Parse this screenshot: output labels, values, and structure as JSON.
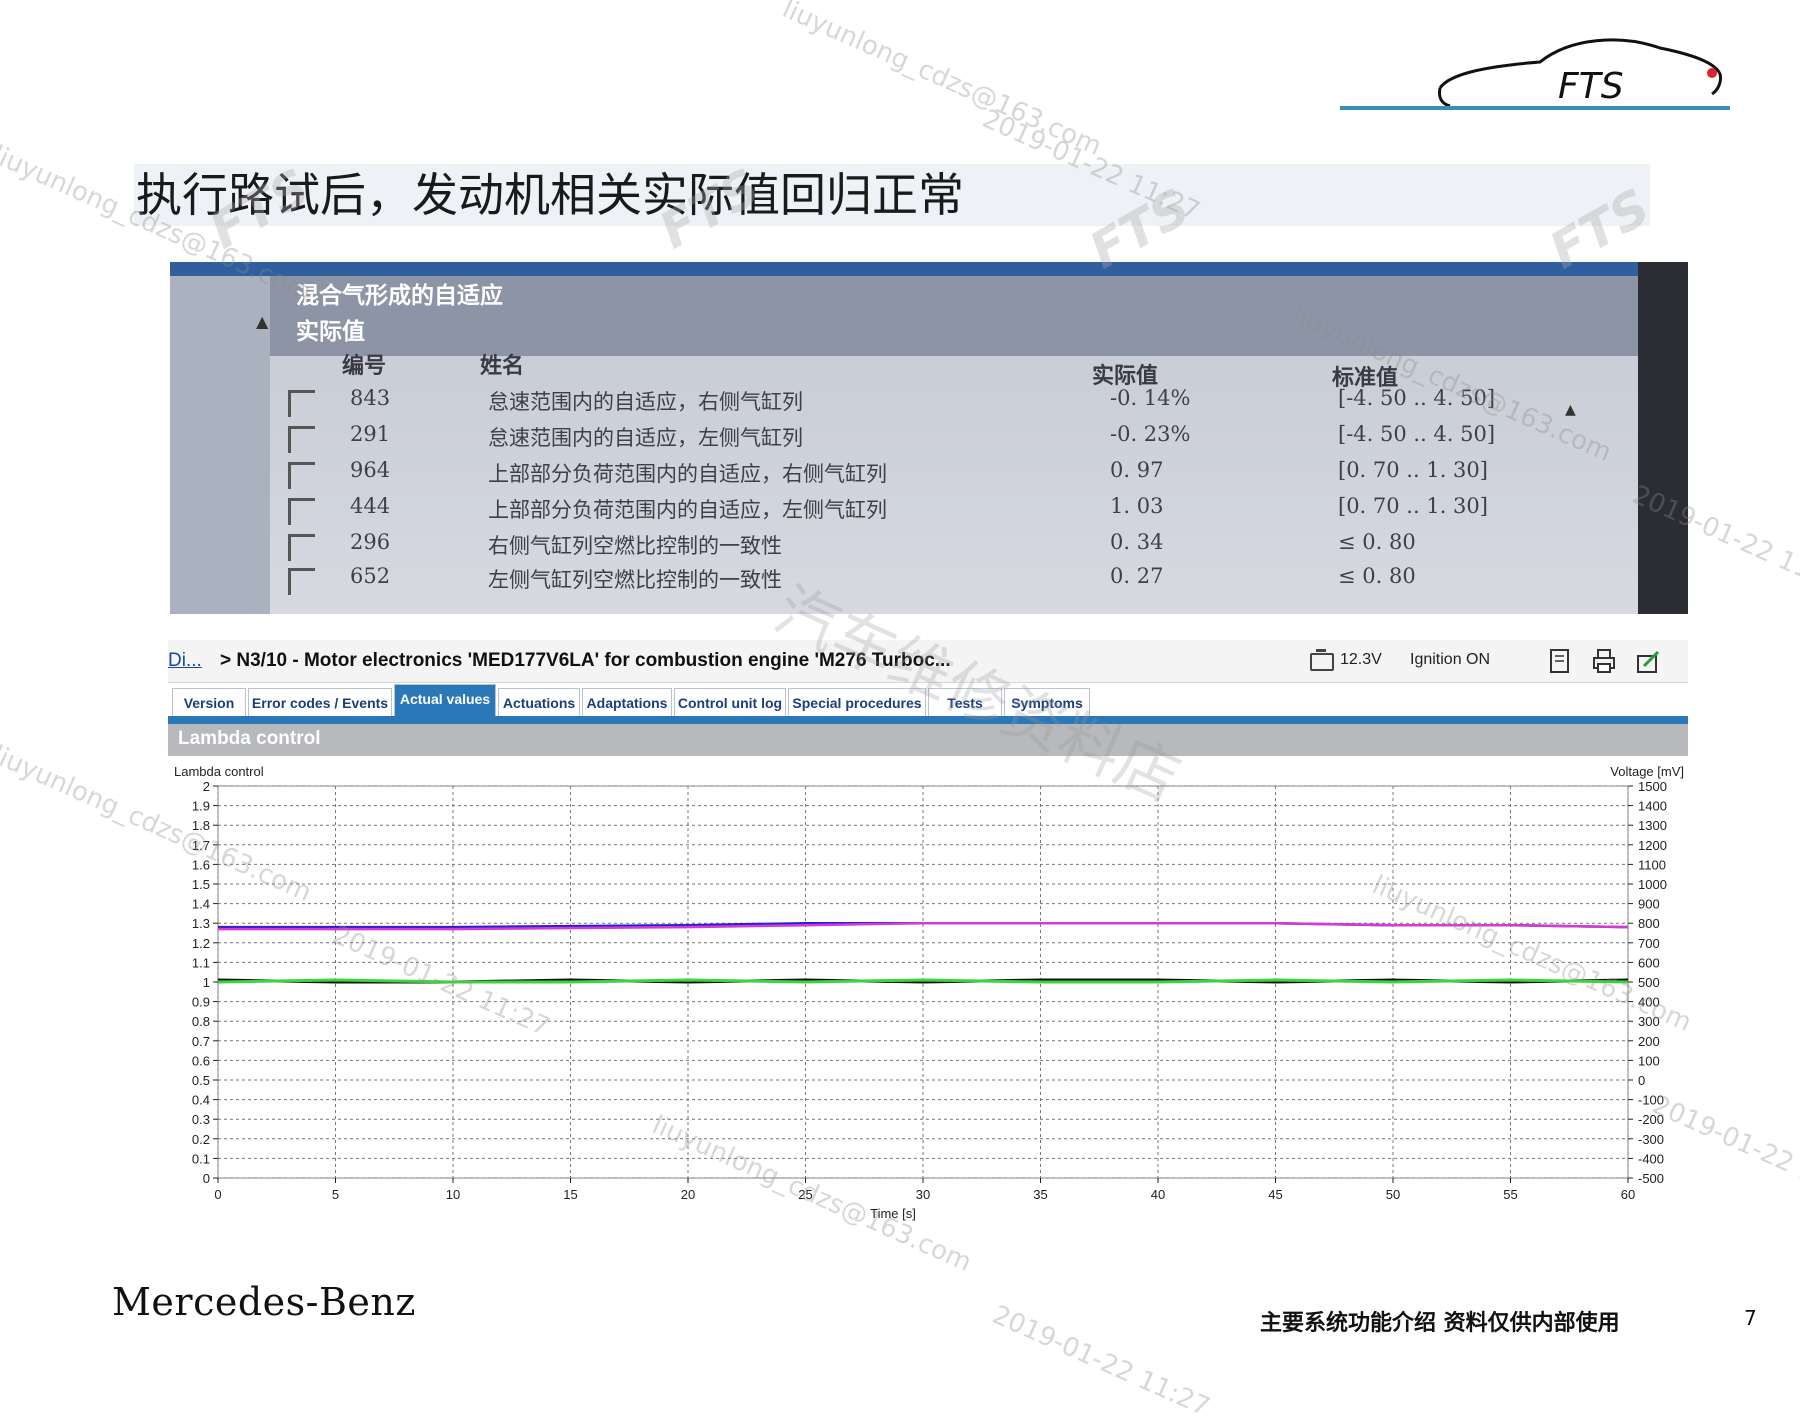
{
  "slide": {
    "title": "执行路试后，发动机相关实际值回归正常",
    "logo_text": "FTS",
    "brand": "Mercedes-Benz",
    "footer_note": "主要系统功能介绍  资料仅供内部使用",
    "page_number": "7"
  },
  "photo_table": {
    "section_title": "混合气形成的自适应",
    "subsection_title": "实际值",
    "headers": {
      "number": "编号",
      "name": "姓名",
      "actual": "实际值",
      "standard": "标准值"
    },
    "rows": [
      {
        "number": "843",
        "name": "怠速范围内的自适应，右侧气缸列",
        "actual": "-0. 14%",
        "standard": "[-4. 50  ..  4. 50]"
      },
      {
        "number": "291",
        "name": "怠速范围内的自适应，左侧气缸列",
        "actual": "-0. 23%",
        "standard": "[-4. 50  ..  4. 50]"
      },
      {
        "number": "964",
        "name": "上部部分负荷范围内的自适应，右侧气缸列",
        "actual": "0. 97",
        "standard": "[0. 70  ..  1. 30]"
      },
      {
        "number": "444",
        "name": "上部部分负荷范围内的自适应，左侧气缸列",
        "actual": "1. 03",
        "standard": "[0. 70  ..  1. 30]"
      },
      {
        "number": "296",
        "name": "右侧气缸列空燃比控制的一致性",
        "actual": "0. 34",
        "standard": "≤  0. 80"
      },
      {
        "number": "652",
        "name": "左侧气缸列空燃比控制的一致性",
        "actual": "0. 27",
        "standard": "≤  0. 80"
      }
    ]
  },
  "app": {
    "breadcrumb_link": "Di...",
    "breadcrumb": "> N3/10 - Motor electronics 'MED177V6LA' for combustion engine 'M276 Turboc...",
    "voltage": "12.3V",
    "ignition": "Ignition ON",
    "icons": [
      "document-icon",
      "print-icon",
      "edit-icon"
    ],
    "tabs": [
      "Version",
      "Error codes / Events",
      "Actual values",
      "Actuations",
      "Adaptations",
      "Control unit log",
      "Special procedures",
      "Tests",
      "Symptoms"
    ],
    "active_tab": "Actual values",
    "section_title": "Lambda control"
  },
  "chart_data": {
    "type": "line",
    "title": "",
    "left_axis_label": "Lambda control",
    "right_axis_label": "Voltage [mV]",
    "xlabel": "Time [s]",
    "xlim": [
      0,
      60
    ],
    "ylim": [
      0,
      2
    ],
    "y2lim": [
      -500,
      1500
    ],
    "x_ticks": [
      "0",
      "5",
      "10",
      "15",
      "20",
      "25",
      "30",
      "35",
      "40",
      "45",
      "50",
      "55",
      "60"
    ],
    "y_ticks": [
      "0",
      "0.1",
      "0.2",
      "0.3",
      "0.4",
      "0.5",
      "0.6",
      "0.7",
      "0.8",
      "0.9",
      "1",
      "1.1",
      "1.2",
      "1.3",
      "1.4",
      "1.5",
      "1.6",
      "1.7",
      "1.8",
      "1.9",
      "2"
    ],
    "y2_ticks": [
      "-500",
      "-400",
      "-300",
      "-200",
      "-100",
      "0",
      "100",
      "200",
      "300",
      "400",
      "500",
      "600",
      "700",
      "800",
      "900",
      "1000",
      "1100",
      "1200",
      "1300",
      "1400",
      "1500"
    ],
    "grid": true,
    "series": [
      {
        "color": "#2a1fd0",
        "x": [
          0,
          10,
          20,
          25,
          30,
          40,
          45,
          50,
          55,
          60
        ],
        "values": [
          1.28,
          1.28,
          1.29,
          1.3,
          1.3,
          1.3,
          1.3,
          1.29,
          1.29,
          1.28
        ]
      },
      {
        "color": "#d43bd4",
        "x": [
          0,
          10,
          20,
          25,
          30,
          40,
          45,
          50,
          55,
          60
        ],
        "values": [
          1.27,
          1.27,
          1.28,
          1.29,
          1.3,
          1.3,
          1.3,
          1.29,
          1.29,
          1.28
        ]
      },
      {
        "color": "#111111",
        "x": [
          0,
          5,
          10,
          15,
          20,
          25,
          30,
          35,
          40,
          45,
          50,
          55,
          60
        ],
        "values": [
          1.01,
          1.0,
          1.0,
          1.01,
          1.0,
          1.01,
          1.0,
          1.01,
          1.01,
          1.0,
          1.01,
          1.0,
          1.01
        ]
      },
      {
        "color": "#3bd43b",
        "x": [
          0,
          5,
          10,
          15,
          20,
          25,
          30,
          35,
          40,
          45,
          50,
          55,
          60
        ],
        "values": [
          1.0,
          1.01,
          1.0,
          1.0,
          1.01,
          1.0,
          1.01,
          1.0,
          1.0,
          1.01,
          1.0,
          1.01,
          1.0
        ]
      }
    ]
  },
  "watermarks": {
    "email": "liuyunlong_cdzs@163.com",
    "timestamp": "2019-01-22 11:27",
    "shop": "汽车维修资料店",
    "logo": "FTS"
  }
}
